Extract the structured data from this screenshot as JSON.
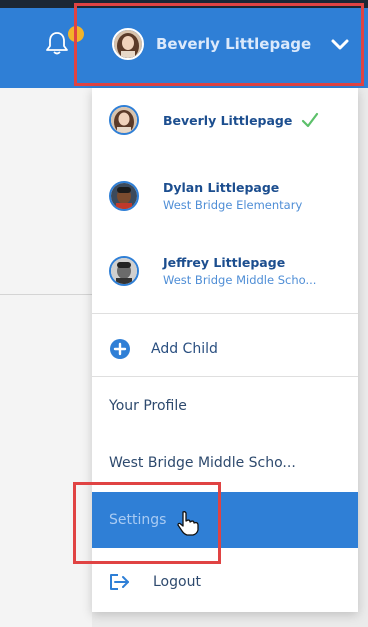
{
  "header": {
    "current_user": "Beverly Littlepage",
    "has_notification": true
  },
  "menu": {
    "children": [
      {
        "name": "Beverly Littlepage",
        "school": "",
        "selected": true
      },
      {
        "name": "Dylan Littlepage",
        "school": "West Bridge Elementary",
        "selected": false
      },
      {
        "name": "Jeffrey Littlepage",
        "school": "West Bridge Middle Scho...",
        "selected": false
      }
    ],
    "add_child_label": "Add Child",
    "your_profile_label": "Your Profile",
    "school_label": "West Bridge Middle Scho...",
    "settings_label": "Settings",
    "logout_label": "Logout"
  },
  "colors": {
    "topbar": "#2f7fd6",
    "active_item": "#2f7fd6",
    "highlight_box": "#e04343",
    "check": "#5cc06a",
    "notification_dot": "#f2b32a"
  },
  "icons": [
    "bell-icon",
    "chevron-down-icon",
    "check-icon",
    "plus-circle-icon",
    "logout-icon",
    "hand-pointer-icon"
  ]
}
